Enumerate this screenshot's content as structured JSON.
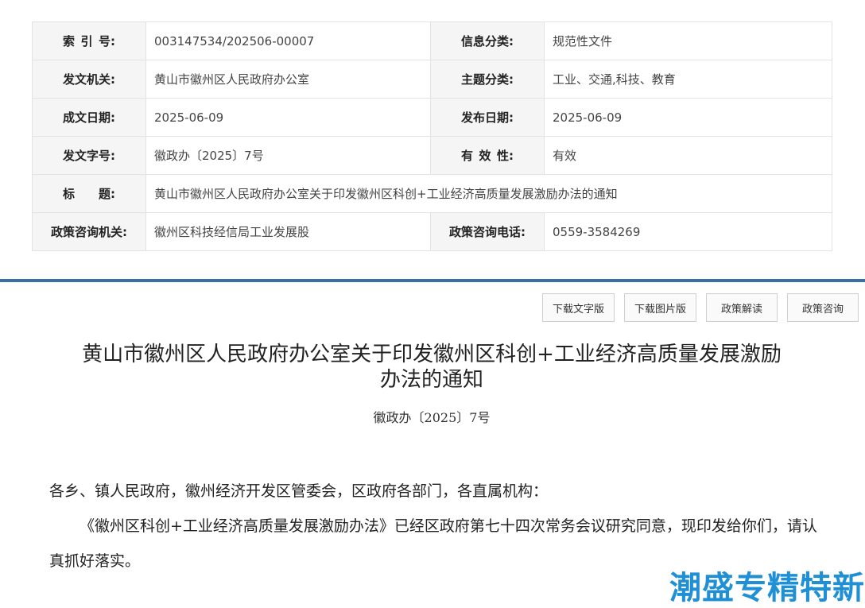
{
  "meta": {
    "rows": [
      {
        "l1": "索引号",
        "v1": "003147534/202506-00007",
        "l2": "信息分类",
        "v2": "规范性文件"
      },
      {
        "l1": "发文机关",
        "v1": "黄山市徽州区人民政府办公室",
        "l2": "主题分类",
        "v2": "工业、交通,科技、教育"
      },
      {
        "l1": "成文日期",
        "v1": "2025-06-09",
        "l2": "发布日期",
        "v2": "2025-06-09"
      },
      {
        "l1": "发文字号",
        "v1": "徽政办〔2025〕7号",
        "l2": "有效性",
        "v2": "有效"
      }
    ],
    "title_label": "标题",
    "title_value": "黄山市徽州区人民政府办公室关于印发徽州区科创+工业经济高质量发展激励办法的通知",
    "contact_org_label": "政策咨询机关:",
    "contact_org_value": "徽州区科技经信局工业发展股",
    "contact_phone_label": "政策咨询电话:",
    "contact_phone_value": "0559-3584269"
  },
  "toolbar": {
    "download_text": "下载文字版",
    "download_image": "下载图片版",
    "policy_interpretation": "政策解读",
    "policy_consult": "政策咨询"
  },
  "document": {
    "title_line1": "黄山市徽州区人民政府办公室关于印发徽州区科创+工业经济高质量发展激励",
    "title_line2": "办法的通知",
    "number": "徽政办〔2025〕7号",
    "salutation": "各乡、镇人民政府，徽州经济开发区管委会，区政府各部门，各直属机构：",
    "paragraph1": "《徽州区科创+工业经济高质量发展激励办法》已经区政府第七十四次常务会议研究同意，现印发给你们，请认真抓好落实。"
  },
  "watermark": "潮盛专精特新"
}
